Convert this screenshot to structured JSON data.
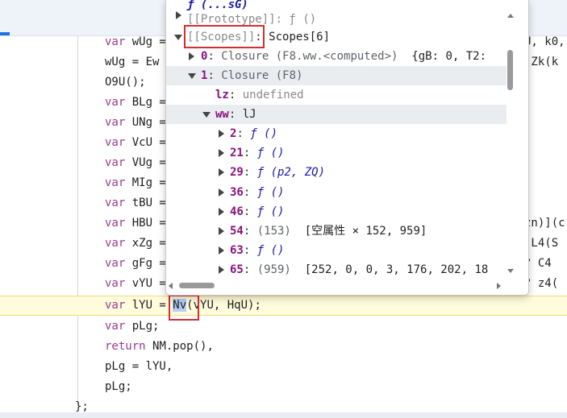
{
  "editor": {
    "lines": [
      {
        "kw": "var ",
        "text": "wUg = ",
        "tail": "U, k0,"
      },
      {
        "kw": "",
        "text": "wUg = Ew",
        "tail": "[Zk(k"
      },
      {
        "kw": "",
        "text": "O9U();",
        "tail": ""
      },
      {
        "kw": "var ",
        "text": "BLg =",
        "tail": ""
      },
      {
        "kw": "var ",
        "text": "UNg =",
        "tail": ""
      },
      {
        "kw": "var ",
        "text": "VcU =",
        "tail": ""
      },
      {
        "kw": "var ",
        "text": "VUg =",
        "tail": ""
      },
      {
        "kw": "var ",
        "text": "MIg =",
        "tail": ""
      },
      {
        "kw": "var ",
        "text": "tBU =",
        "tail": ""
      },
      {
        "kw": "var ",
        "text": "HBU =",
        "tail": "zn)](c"
      },
      {
        "kw": "var ",
        "text": "xZg =",
        "tail": "[L4(S"
      },
      {
        "kw": "var ",
        "text": "gFg =",
        "tail": "? C4"
      },
      {
        "kw": "var ",
        "text": "vYU =",
        "tail": "? z4("
      }
    ],
    "current_line": {
      "kw": "var ",
      "before": "lYU = ",
      "highlight": "Nv",
      "after": "(vYU, HqU);"
    },
    "after_lines": [
      {
        "kw": "var ",
        "text": "pLg;"
      },
      {
        "kw": "return ",
        "text": "NM.pop(),"
      },
      {
        "kw": "",
        "text": "pLg = lYU,"
      },
      {
        "kw": "",
        "text": "pLg;"
      }
    ],
    "closing": "};"
  },
  "popover": {
    "header_fn": "ƒ (...sG)",
    "prototype_row": "[[Prototype]]: ƒ ()",
    "scopes": {
      "key": "[[Scopes]]",
      "sep": ": ",
      "value": "Scopes[6]"
    },
    "closure0": {
      "index": "0",
      "label": "Closure (F8.ww.<computed>)",
      "preview": "{gB: 0, T2:"
    },
    "closure1": {
      "index": "1",
      "label": "Closure (F8)"
    },
    "lz": {
      "key": "lz",
      "value": "undefined"
    },
    "ww": {
      "key": "ww",
      "value": "lJ"
    },
    "items": [
      {
        "key": "2",
        "sep": ": ",
        "value": "ƒ ()",
        "type": "fn"
      },
      {
        "key": "21",
        "sep": ": ",
        "value": "ƒ ()",
        "type": "fn"
      },
      {
        "key": "29",
        "sep": ": ",
        "value": "ƒ (p2, ZQ)",
        "type": "fn"
      },
      {
        "key": "36",
        "sep": ": ",
        "value": "ƒ ()",
        "type": "fn"
      },
      {
        "key": "46",
        "sep": ": ",
        "value": "ƒ ()",
        "type": "fn"
      },
      {
        "key": "54",
        "sep": ": ",
        "value": "(153)",
        "preview": "[空属性 × 152, 959]",
        "type": "arr"
      },
      {
        "key": "63",
        "sep": ": ",
        "value": "ƒ ()",
        "type": "fn"
      },
      {
        "key": "65",
        "sep": ": ",
        "value": "(959)",
        "preview": "[252, 0, 0, 3, 176, 202, 18",
        "type": "arr"
      }
    ]
  }
}
